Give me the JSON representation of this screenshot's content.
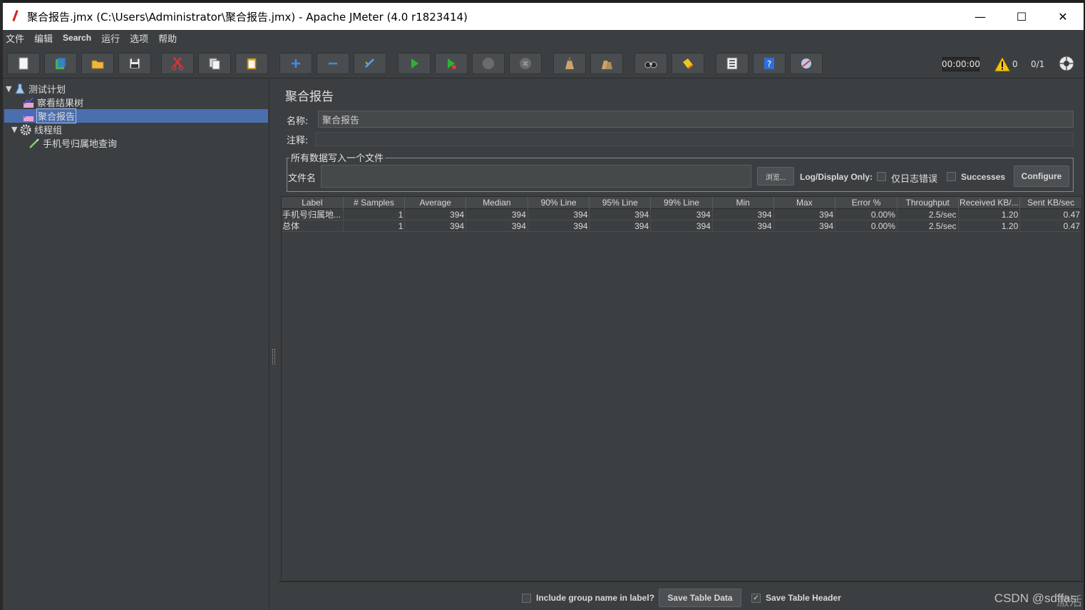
{
  "window": {
    "title": "聚合报告.jmx (C:\\Users\\Administrator\\聚合报告.jmx) - Apache JMeter (4.0 r1823414)",
    "minimize": "—",
    "maximize": "☐",
    "close": "✕"
  },
  "menu": [
    "文件",
    "编辑",
    "Search",
    "运行",
    "选项",
    "帮助"
  ],
  "toolbar": {
    "buttons": [
      "new-icon",
      "templates-icon",
      "open-icon",
      "save-icon",
      "cut-icon",
      "copy-icon",
      "paste-icon",
      "expand-icon",
      "collapse-icon",
      "toggle-icon",
      "start-icon",
      "start-no-pause-icon",
      "stop-icon",
      "shutdown-icon",
      "clear-icon",
      "clear-all-icon",
      "search-icon",
      "reset-search-icon",
      "function-helper-icon",
      "help-icon",
      "remote-icon"
    ],
    "timer": "00:00:00",
    "warning_count": "0",
    "threads": "0/1"
  },
  "tree": {
    "items": [
      {
        "label": "测试计划",
        "icon": "test-plan-icon"
      },
      {
        "label": "察看结果树",
        "icon": "listener-icon"
      },
      {
        "label": "聚合报告",
        "icon": "listener-icon"
      },
      {
        "label": "线程组",
        "icon": "thread-group-icon"
      },
      {
        "label": "手机号归属地查询",
        "icon": "sampler-icon"
      }
    ]
  },
  "panel": {
    "title": "聚合报告",
    "name_label": "名称:",
    "name_value": "聚合报告",
    "comment_label": "注释:",
    "comment_value": "",
    "group_title": "所有数据写入一个文件",
    "filename_label": "文件名",
    "filename_value": "",
    "browse_button": "浏览...",
    "log_display_label": "Log/Display Only:",
    "errors_only_label": "仅日志错误",
    "successes_label": "Successes",
    "configure_button": "Configure"
  },
  "table": {
    "headers": [
      "Label",
      "# Samples",
      "Average",
      "Median",
      "90% Line",
      "95% Line",
      "99% Line",
      "Min",
      "Max",
      "Error %",
      "Throughput",
      "Received KB/...",
      "Sent KB/sec"
    ],
    "rows": [
      [
        "手机号归属地...",
        "1",
        "394",
        "394",
        "394",
        "394",
        "394",
        "394",
        "394",
        "0.00%",
        "2.5/sec",
        "1.20",
        "0.47"
      ],
      [
        "总体",
        "1",
        "394",
        "394",
        "394",
        "394",
        "394",
        "394",
        "394",
        "0.00%",
        "2.5/sec",
        "1.20",
        "0.47"
      ]
    ]
  },
  "footer": {
    "include_group_label": "Include group name in label?",
    "include_group_checked": false,
    "save_table_data": "Save Table Data",
    "save_table_header_label": "Save Table Header",
    "save_table_header_checked": true
  },
  "watermark": "CSDN @sdffas",
  "watermark2": "激活"
}
